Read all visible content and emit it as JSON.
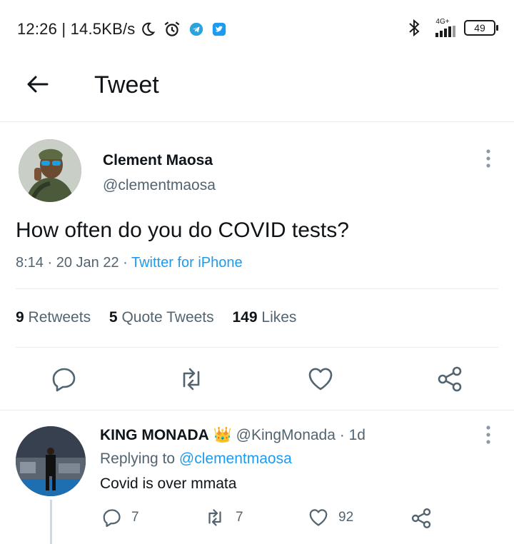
{
  "status_bar": {
    "time": "12:26 | 14.5KB/s",
    "network": "4G+",
    "battery": "49",
    "icons": [
      "moon-icon",
      "alarm-icon",
      "telegram-icon",
      "twitter-icon",
      "bluetooth-icon",
      "signal-icon",
      "battery-icon"
    ]
  },
  "header": {
    "title": "Tweet"
  },
  "tweet": {
    "author_name": "Clement Maosa",
    "author_handle": "@clementmaosa",
    "text": "How often do you do COVID tests?",
    "time": "8:14",
    "date": "20 Jan 22",
    "source": "Twitter for iPhone",
    "retweets_count": "9",
    "retweets_label": "Retweets",
    "quotes_count": "5",
    "quotes_label": "Quote Tweets",
    "likes_count": "149",
    "likes_label": "Likes"
  },
  "reply": {
    "author_name": "KING MONADA",
    "badge": "👑",
    "author_handle": "@KingMonada",
    "age": "1d",
    "replying_prefix": "Replying to",
    "replying_to": "@clementmaosa",
    "text": "Covid is over mmata",
    "reply_count": "7",
    "retweet_count": "7",
    "like_count": "92"
  },
  "colors": {
    "accent": "#1d9bf0",
    "text_primary": "#0f1419",
    "text_secondary": "#536471",
    "divider": "#e6ecf0"
  }
}
